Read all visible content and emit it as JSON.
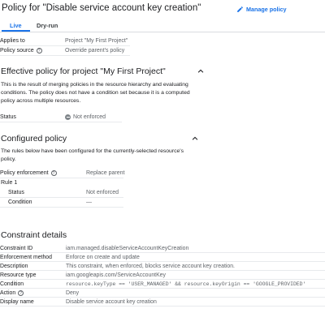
{
  "header": {
    "title": "Policy for \"Disable service account key creation\"",
    "manage_label": "Manage policy"
  },
  "tabs": [
    {
      "label": "Live",
      "active": true
    },
    {
      "label": "Dry-run",
      "active": false
    }
  ],
  "summary": {
    "applies_to_label": "Applies to",
    "applies_to_value": "Project \"My First Project\"",
    "policy_source_label": "Policy source",
    "policy_source_value": "Override parent's policy"
  },
  "effective": {
    "title": "Effective policy for project \"My First Project\"",
    "description": "This is the result of merging policies in the resource hierarchy and evaluating conditions. The policy does not have a condition set because it is a computed policy across multiple resources.",
    "status_label": "Status",
    "status_value": "Not enforced"
  },
  "configured": {
    "title": "Configured policy",
    "description": "The rules below have been configured for the currently-selected resource's policy.",
    "enforcement_label": "Policy enforcement",
    "enforcement_value": "Replace parent",
    "rule_label": "Rule 1",
    "rule_status_label": "Status",
    "rule_status_value": "Not enforced",
    "rule_condition_label": "Condition",
    "rule_condition_value": "—"
  },
  "constraint": {
    "title": "Constraint details",
    "rows": [
      {
        "label": "Constraint ID",
        "value": "iam.managed.disableServiceAccountKeyCreation"
      },
      {
        "label": "Enforcement method",
        "value": "Enforce on create and update"
      },
      {
        "label": "Description",
        "value": "This constraint, when enforced, blocks service account key creation."
      },
      {
        "label": "Resource type",
        "value": "iam.googleapis.com/ServiceAccountKey"
      },
      {
        "label": "Condition",
        "value": "resource.keyType == 'USER_MANAGED' && resource.keyOrigin == 'GOOGLE_PROVIDED'"
      },
      {
        "label": "Action",
        "value": "Deny"
      },
      {
        "label": "Display name",
        "value": "Disable service account key creation"
      }
    ]
  },
  "colors": {
    "accent": "#1a73e8",
    "text": "#202124",
    "muted": "#5f6368",
    "divider": "#e8eaed"
  }
}
